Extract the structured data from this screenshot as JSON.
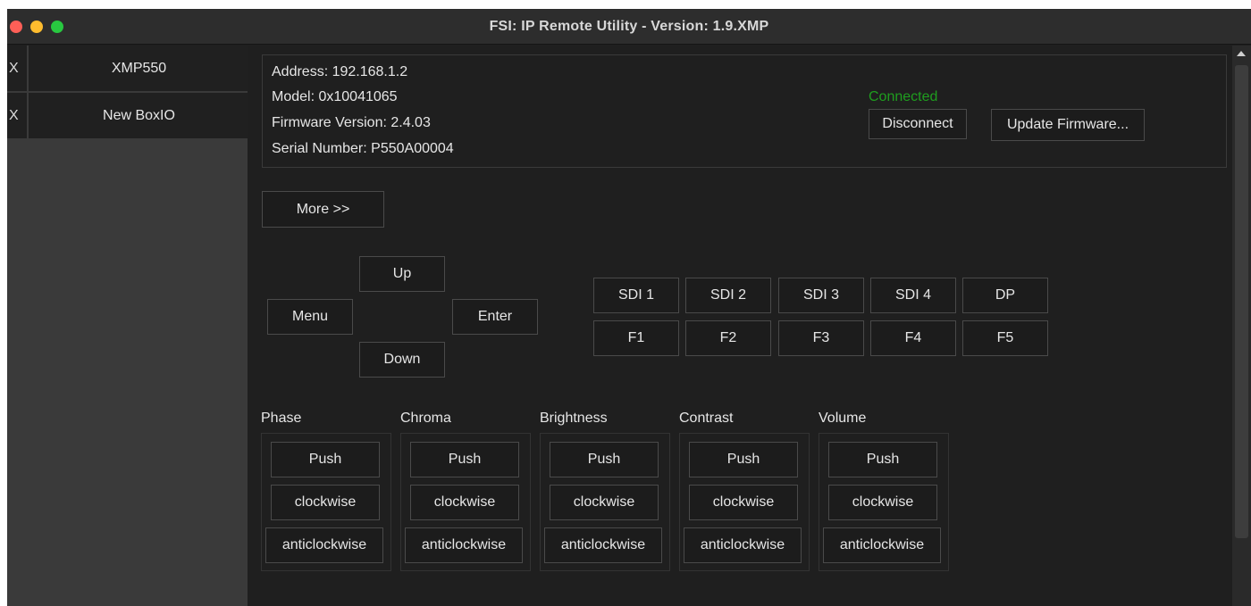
{
  "window": {
    "title": "FSI: IP Remote Utility - Version: 1.9.XMP"
  },
  "sidebar": {
    "items": [
      {
        "close": "X",
        "label": "XMP550"
      },
      {
        "close": "X",
        "label": "New BoxIO"
      }
    ]
  },
  "device": {
    "address": "Address: 192.168.1.2",
    "model": "Model: 0x10041065",
    "firmware": "Firmware Version: 2.4.03",
    "serial": "Serial Number: P550A00004",
    "status": "Connected",
    "disconnect_label": "Disconnect",
    "update_label": "Update Firmware..."
  },
  "more_label": "More >>",
  "nav": {
    "up": "Up",
    "menu": "Menu",
    "enter": "Enter",
    "down": "Down"
  },
  "inputs": [
    "SDI 1",
    "SDI 2",
    "SDI 3",
    "SDI 4",
    "DP"
  ],
  "functions": [
    "F1",
    "F2",
    "F3",
    "F4",
    "F5"
  ],
  "knobs": [
    {
      "name": "Phase",
      "push": "Push",
      "cw": "clockwise",
      "ccw": "anticlockwise"
    },
    {
      "name": "Chroma",
      "push": "Push",
      "cw": "clockwise",
      "ccw": "anticlockwise"
    },
    {
      "name": "Brightness",
      "push": "Push",
      "cw": "clockwise",
      "ccw": "anticlockwise"
    },
    {
      "name": "Contrast",
      "push": "Push",
      "cw": "clockwise",
      "ccw": "anticlockwise"
    },
    {
      "name": "Volume",
      "push": "Push",
      "cw": "clockwise",
      "ccw": "anticlockwise"
    }
  ],
  "colors": {
    "status_connected": "#1f9e1f",
    "background": "#1f1f1f",
    "sidebar": "#3a3a3a"
  }
}
